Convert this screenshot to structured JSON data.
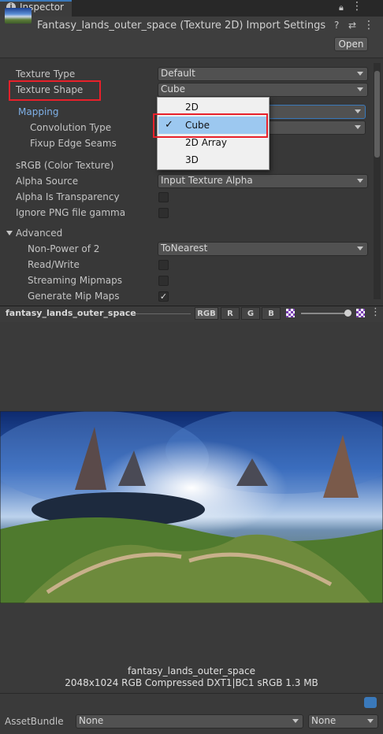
{
  "tab": {
    "title": "Inspector"
  },
  "header": {
    "title": "Fantasy_lands_outer_space (Texture 2D) Import Settings",
    "open_label": "Open"
  },
  "fields": {
    "texture_type": {
      "label": "Texture Type",
      "value": "Default"
    },
    "texture_shape": {
      "label": "Texture Shape",
      "value": "Cube"
    },
    "mapping": {
      "label": "Mapping"
    },
    "convolution_type": {
      "label": "Convolution Type"
    },
    "fixup_edge_seams": {
      "label": "Fixup Edge Seams"
    },
    "srgb": {
      "label": "sRGB (Color Texture)"
    },
    "alpha_source": {
      "label": "Alpha Source",
      "value": "Input Texture Alpha"
    },
    "alpha_is_transparency": {
      "label": "Alpha Is Transparency",
      "checked": false
    },
    "ignore_png_gamma": {
      "label": "Ignore PNG file gamma",
      "checked": false
    },
    "advanced": {
      "label": "Advanced"
    },
    "non_power_of_2": {
      "label": "Non-Power of 2",
      "value": "ToNearest"
    },
    "read_write": {
      "label": "Read/Write",
      "checked": false
    },
    "streaming_mipmaps": {
      "label": "Streaming Mipmaps",
      "checked": false
    },
    "generate_mip_maps": {
      "label": "Generate Mip Maps",
      "checked": true
    }
  },
  "popup": {
    "options": [
      "2D",
      "Cube",
      "2D Array",
      "3D"
    ],
    "selected": "Cube",
    "check_mark": "✓"
  },
  "preview": {
    "name": "fantasy_lands_outer_space",
    "channels": [
      "RGB",
      "R",
      "G",
      "B"
    ],
    "caption_name": "fantasy_lands_outer_space",
    "caption_info": "2048x1024  RGB Compressed DXT1|BC1 sRGB   1.3 MB"
  },
  "footer": {
    "asset_bundle_label": "AssetBundle",
    "bundle_value": "None",
    "variant_value": "None"
  },
  "colors": {
    "accent": "#3a79bb",
    "highlight": "#e8202a",
    "selected_bg": "#9cc8f0"
  }
}
